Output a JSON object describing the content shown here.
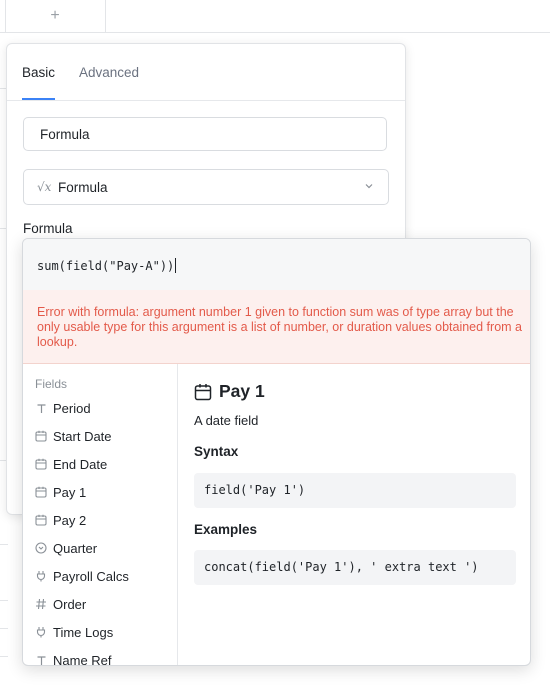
{
  "grid": {
    "add_icon": "+"
  },
  "panel": {
    "tabs": [
      {
        "label": "Basic",
        "active": true
      },
      {
        "label": "Advanced",
        "active": false
      }
    ],
    "field_name_value": "Formula",
    "field_type": {
      "icon": "√x",
      "label": "Formula"
    },
    "formula_heading": "Formula"
  },
  "editor": {
    "code": "sum(field(\"Pay-A\"))",
    "error": "Error with formula: argument number 1 given to function sum was of type array but the only usable type for this argument is a list of number, or duration values obtained from a lookup.",
    "fields_title": "Fields",
    "fields": [
      {
        "label": "Period",
        "icon": "text-icon"
      },
      {
        "label": "Start Date",
        "icon": "calendar-icon"
      },
      {
        "label": "End Date",
        "icon": "calendar-icon"
      },
      {
        "label": "Pay 1",
        "icon": "calendar-icon"
      },
      {
        "label": "Pay 2",
        "icon": "calendar-icon"
      },
      {
        "label": "Quarter",
        "icon": "single-select-icon"
      },
      {
        "label": "Payroll Calcs",
        "icon": "link-icon"
      },
      {
        "label": "Order",
        "icon": "number-icon"
      },
      {
        "label": "Time Logs",
        "icon": "link-icon"
      },
      {
        "label": "Name Ref",
        "icon": "text-icon"
      }
    ],
    "doc": {
      "title": "Pay 1",
      "description": "A date field",
      "syntax_heading": "Syntax",
      "syntax": "field('Pay 1')",
      "examples_heading": "Examples",
      "example": "concat(field('Pay 1'), ' extra text ')"
    }
  },
  "colors": {
    "accent": "#3b82f6",
    "error_text": "#e35a4a",
    "error_bg": "#fdf0ee"
  }
}
